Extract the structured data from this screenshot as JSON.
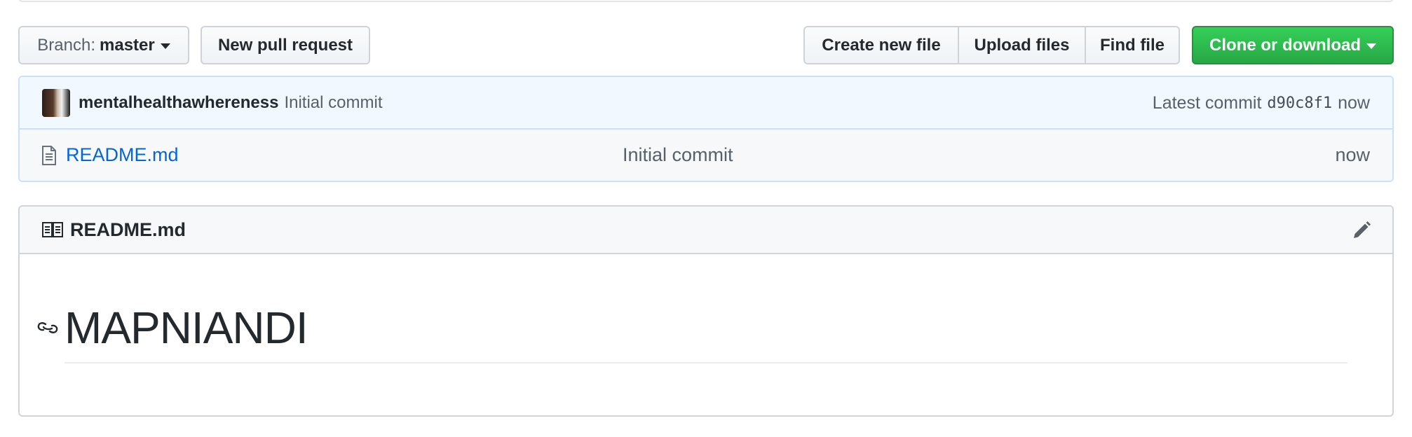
{
  "toolbar": {
    "branch_label": "Branch:",
    "branch_value": "master",
    "new_pr": "New pull request",
    "create_file": "Create new file",
    "upload_files": "Upload files",
    "find_file": "Find file",
    "clone": "Clone or download"
  },
  "commit": {
    "author": "mentalhealthawhereness",
    "message": "Initial commit",
    "latest_label": "Latest commit",
    "sha": "d90c8f1",
    "age": "now"
  },
  "files": [
    {
      "name": "README.md",
      "message": "Initial commit",
      "age": "now",
      "icon": "file-icon"
    }
  ],
  "readme": {
    "title": "README.md",
    "heading": "MAPNIANDI"
  },
  "colors": {
    "link": "#0366d6",
    "clone_green": "#28a745",
    "commit_bar_bg": "#f1f8ff"
  }
}
